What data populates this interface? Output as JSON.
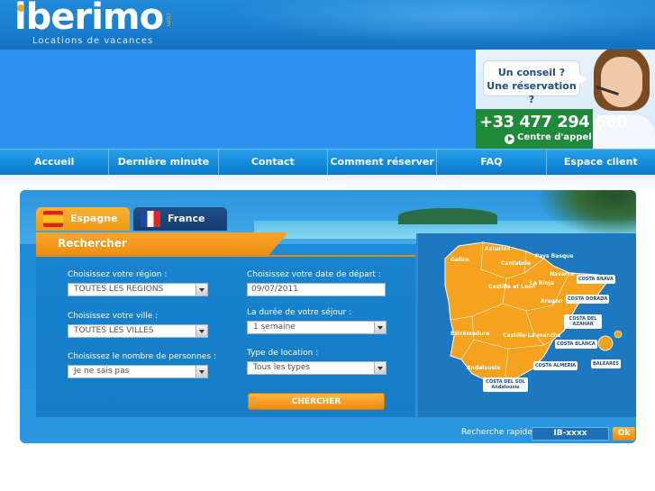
{
  "brand": {
    "name": "iberimo",
    "tld": ".com",
    "tagline": "Locations de vacances"
  },
  "callbox": {
    "line1": "Un conseil ?",
    "line2": "Une réservation ?",
    "phone": "+33 477 294 680",
    "centre": "Centre d'appel"
  },
  "nav": {
    "items": [
      {
        "label": "Accueil"
      },
      {
        "label": "Dernière minute"
      },
      {
        "label": "Contact"
      },
      {
        "label": "Comment réserver"
      },
      {
        "label": "FAQ"
      },
      {
        "label": "Espace client"
      }
    ]
  },
  "tabs": [
    {
      "label": "Espagne",
      "active": true
    },
    {
      "label": "France",
      "active": false
    }
  ],
  "search": {
    "title": "Rechercher",
    "region_label": "Choisissez votre région :",
    "region_value": "TOUTES LES REGIONS",
    "city_label": "Choisissez votre ville :",
    "city_value": "TOUTES LES VILLES",
    "persons_label": "Choisissez le nombre de personnes :",
    "persons_value": "Je ne sais pas",
    "date_label": "Choisissez votre date de départ :",
    "date_value": "09/07/2011",
    "duration_label": "La durée de votre séjour :",
    "duration_value": "1 semaine",
    "type_label": "Type de location :",
    "type_value": "Tous les types",
    "button": "CHERCHER"
  },
  "map": {
    "regions": [
      "Asturies",
      "Galice",
      "Pays Basque",
      "Cantabrie",
      "Navarre",
      "La Rioja",
      "Castille et Leon",
      "Aragon",
      "Estrémadure",
      "Castille-La-manche",
      "Andalousie"
    ],
    "costas": [
      "COSTA BRAVA",
      "COSTA DORADA",
      "COSTA DEL AZAHAR",
      "COSTA BLANCA",
      "COSTA ALMERIA",
      "BALEARES",
      "COSTA DEL SOL Andalousie"
    ]
  },
  "quick": {
    "label": "Recherche rapide",
    "placeholder": "IB-xxxx",
    "button": "Ok"
  },
  "colors": {
    "primary_blue": "#1a7fd0",
    "orange": "#f19a14",
    "green": "#1e8a3a"
  }
}
